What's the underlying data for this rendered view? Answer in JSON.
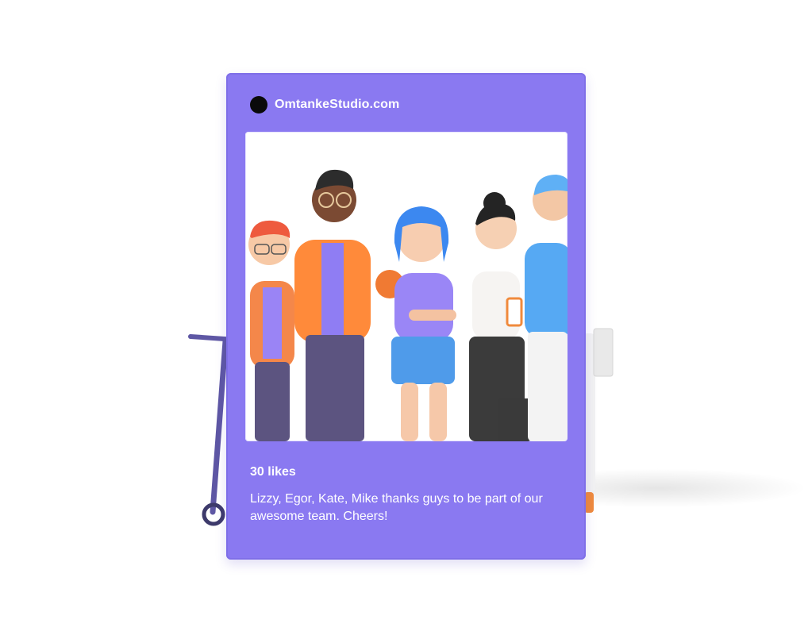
{
  "post": {
    "account": "OmtankeStudio.com",
    "likes": "30 likes",
    "caption": "Lizzy, Egor, Kate, Mike thanks guys to be part of our awesome team. Cheers!"
  },
  "colors": {
    "frame": "#8a79f1",
    "photo_background": "#ffffff",
    "caption_text": "#ffffff",
    "brand_dot": "#0a0a0a"
  },
  "icons": {
    "brand": "black-circle-logo-icon"
  }
}
